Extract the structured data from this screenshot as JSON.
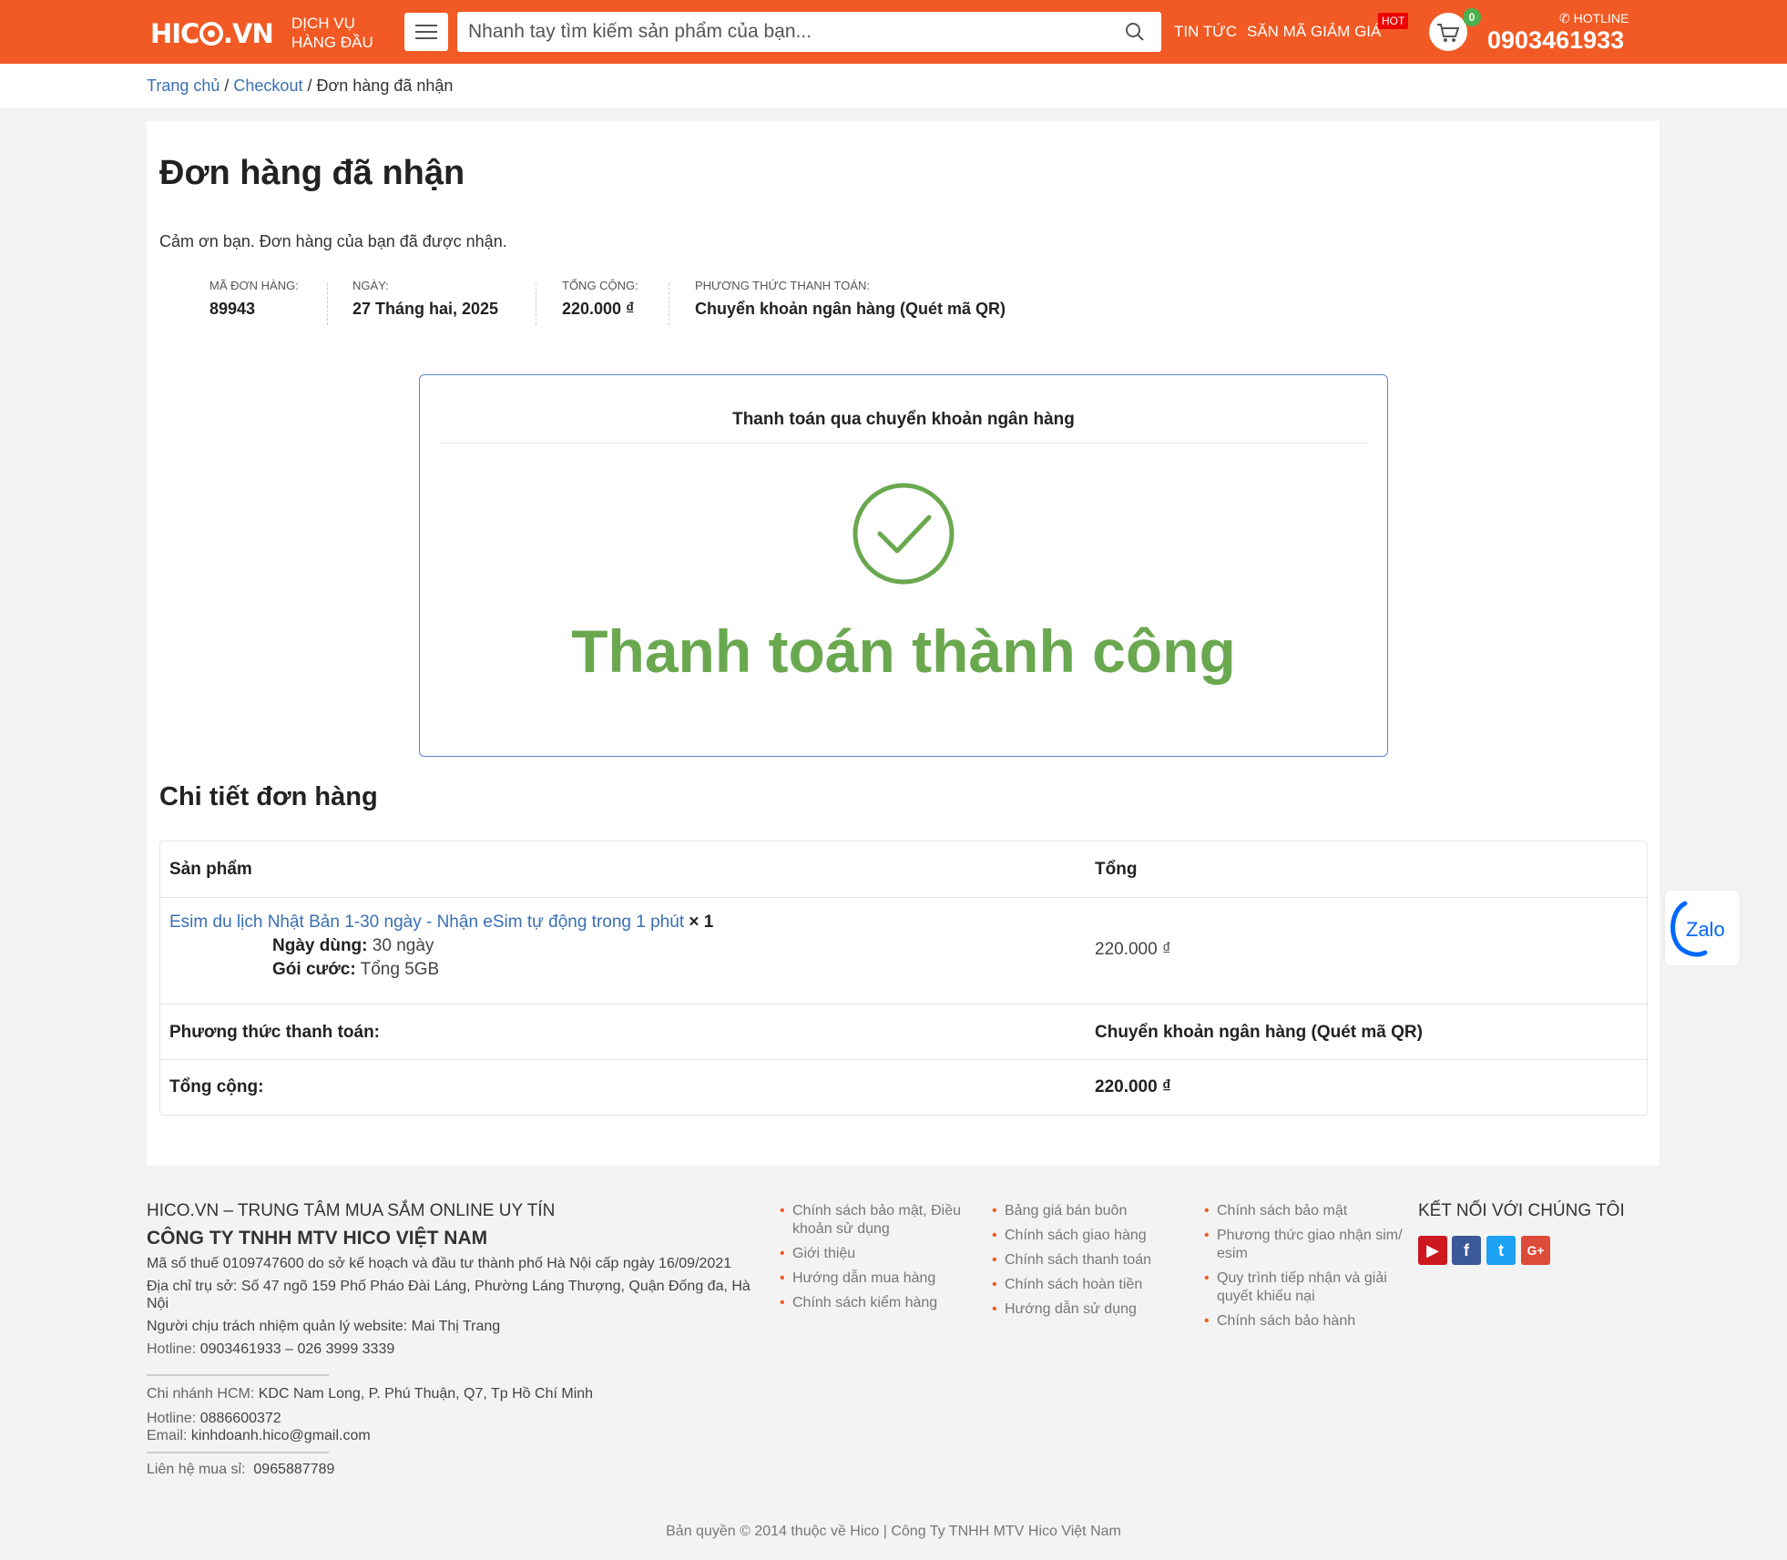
{
  "header": {
    "logo": "HICO.VN",
    "tagline_line1": "DỊCH VỤ",
    "tagline_line2": "HÀNG ĐẦU",
    "search_placeholder": "Nhanh tay tìm kiếm sản phẩm của bạn...",
    "nav_news": "TIN TỨC",
    "nav_coupon": "SĂN MÃ GIẢM GIÁ",
    "hot_badge": "HOT",
    "cart_count": "0",
    "hotline_label": "HOTLINE",
    "hotline_number": "0903461933"
  },
  "breadcrumb": {
    "home": "Trang chủ",
    "sep": " / ",
    "checkout": "Checkout",
    "current": "Đơn hàng đã nhận"
  },
  "order": {
    "title": "Đơn hàng đã nhận",
    "thanks": "Cảm ơn bạn. Đơn hàng của bạn đã được nhận.",
    "overview": [
      {
        "label": "Mã đơn hàng:",
        "value": "89943"
      },
      {
        "label": "Ngày:",
        "value": "27 Tháng hai, 2025"
      },
      {
        "label": "Tổng cộng:",
        "value": "220.000 ₫"
      },
      {
        "label": "Phương thức thanh toán:",
        "value": "Chuyển khoản ngân hàng (Quét mã QR)"
      }
    ]
  },
  "payment_box": {
    "title": "Thanh toán qua chuyển khoản ngân hàng",
    "success": "Thanh toán thành công",
    "success_color": "#6aa84f"
  },
  "details": {
    "title": "Chi tiết đơn hàng",
    "header_product": "Sản phẩm",
    "header_total": "Tổng",
    "item_name": "Esim du lịch Nhật Bản 1-30 ngày - Nhận eSim tự động trong 1 phút",
    "item_qty": "× 1",
    "meta_days_label": "Ngày dùng:",
    "meta_days_value": "30 ngày",
    "meta_plan_label": "Gói cước:",
    "meta_plan_value": "Tổng 5GB",
    "item_total": "220.000 ₫",
    "payment_label": "Phương thức thanh toán:",
    "payment_value": "Chuyển khoản ngân hàng (Quét mã QR)",
    "total_label": "Tổng cộng:",
    "total_value": "220.000 ₫"
  },
  "zalo": {
    "label": "Zalo"
  },
  "footer": {
    "heading1": "HICO.VN – TRUNG TÂM MUA SẮM ONLINE UY TÍN",
    "heading2": "CÔNG TY TNHH MTV HICO VIỆT NAM",
    "tax": "Mã số thuế 0109747600 do sở kế hoạch và đầu tư thành phố Hà Nội cấp ngày 16/09/2021",
    "address": "Địa chỉ trụ sở: Số 47 ngõ 159 Phố Pháo Đài Láng, Phường Láng Thượng, Quận Đống đa, Hà Nội",
    "manager": "Người chịu trách nhiệm quản lý website: Mai Thị Trang",
    "hotline_label": "Hotline:",
    "hotline_value": "0903461933 – 026 3999 3339",
    "branch_label": "Chi nhánh HCM:",
    "branch_value": "KDC Nam Long, P. Phú Thuận, Q7, Tp Hồ Chí Minh",
    "branch_hotline_label": "Hotline:",
    "branch_hotline_value": "0886600372",
    "email_label": "Email:",
    "email_value": "kinhdoanh.hico@gmail.com",
    "wholesale_label": "Liên hệ mua sỉ:",
    "wholesale_value": "0965887789",
    "links_col1": [
      "Chính sách bảo mật, Điều khoản sử dụng",
      "Giới thiệu",
      "Hướng dẫn mua hàng",
      "Chính sách kiểm hàng"
    ],
    "links_col2": [
      "Bảng giá bán buôn",
      "Chính sách giao hàng",
      "Chính sách thanh toán",
      "Chính sách hoàn tiền",
      "Hướng dẫn sử dụng"
    ],
    "links_col3": [
      "Chính sách bảo mật",
      "Phương thức giao nhận sim/ esim",
      "Quy trình tiếp nhận và giải quyết khiếu nại",
      "Chính sách bảo hành"
    ],
    "connect_title": "KẾT NỐI VỚI CHÚNG TÔI",
    "social": [
      {
        "name": "youtube-icon",
        "glyph": "▶",
        "color": "#cc181e"
      },
      {
        "name": "facebook-icon",
        "glyph": "f",
        "color": "#3b5998"
      },
      {
        "name": "twitter-icon",
        "glyph": "t",
        "color": "#1da1f2"
      },
      {
        "name": "google-plus-icon",
        "glyph": "G+",
        "color": "#dd4b39"
      }
    ],
    "copyright": "Bản quyền © 2014 thuộc về Hico | Công Ty TNHH MTV Hico Việt Nam"
  },
  "colors": {
    "brand": "#f15a24",
    "link": "#3a6fb6",
    "success": "#6aa84f",
    "box_border": "#5b86c7"
  }
}
